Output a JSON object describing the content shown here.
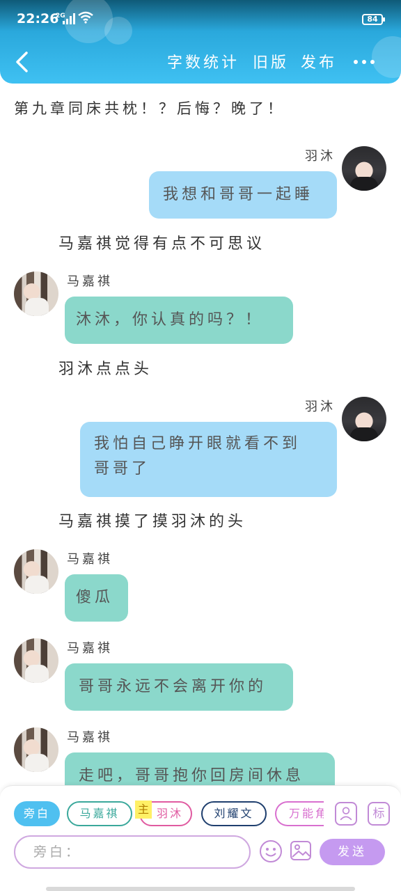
{
  "status_bar": {
    "time": "22:26",
    "signal_label": "2G",
    "battery": "84"
  },
  "header": {
    "nav": [
      "字数统计",
      "旧版",
      "发布"
    ]
  },
  "chapter_title": "第九章同床共枕！？后悔？晚了！",
  "characters": {
    "yumu": "羽沐",
    "majiaqi": "马嘉祺"
  },
  "messages": [
    {
      "speaker": "羽沐",
      "text": "我想和哥哥一起睡"
    },
    {
      "narration": "马嘉祺觉得有点不可思议"
    },
    {
      "speaker": "马嘉祺",
      "text": "沐沐，你认真的吗？！"
    },
    {
      "narration": "羽沐点点头"
    },
    {
      "speaker": "羽沐",
      "line1": "我怕自己睁开眼就看不到",
      "line2": "哥哥了"
    },
    {
      "narration": "马嘉祺摸了摸羽沐的头"
    },
    {
      "speaker": "马嘉祺",
      "text": "傻瓜"
    },
    {
      "speaker": "马嘉祺",
      "text": "哥哥永远不会离开你的"
    },
    {
      "speaker": "马嘉祺",
      "text": "走吧，哥哥抱你回房间休息"
    }
  ],
  "composer": {
    "roles": [
      {
        "label": "旁白",
        "color": "#4fc0f0",
        "active": true
      },
      {
        "label": "马嘉祺",
        "color": "#3aa89b"
      },
      {
        "label": "羽沐",
        "color": "#e05aa0",
        "tag": "主"
      },
      {
        "label": "刘耀文",
        "color": "#1f3f6e"
      },
      {
        "label": "万能角",
        "color": "#d86fcf"
      }
    ],
    "icons": {
      "person": "person-icon",
      "mark": "标"
    },
    "placeholder": "旁白：",
    "send_label": "发送"
  },
  "colors": {
    "header": "#3fc1f2",
    "blue_bubble": "#a5dbf8",
    "teal_bubble": "#8bd8cb",
    "send": "#c59af0"
  }
}
